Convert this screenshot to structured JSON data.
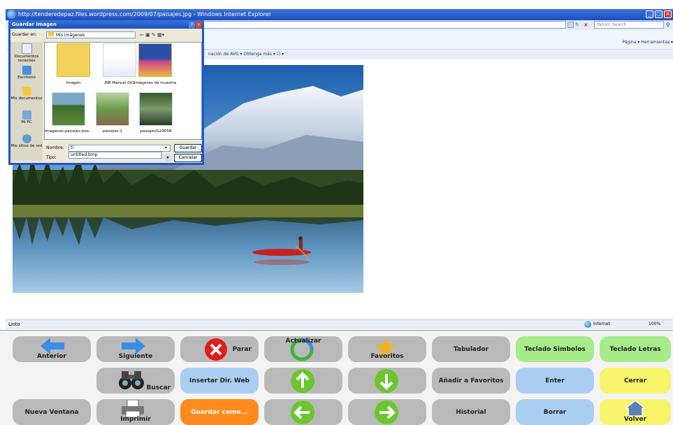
{
  "window": {
    "title": "http://tenderedepaz.files.wordpress.com/2009/07/paisajes.jpg - Windows Internet Explorer",
    "search_placeholder": "Yahoo! Search",
    "links_bar": "nación de AVG ▾   Obtenga más ▾   ☐ ▾",
    "command_bar": "Página ▾   Herramientas ▾",
    "status_left": "Listo",
    "status_zone": "Internet",
    "zoom": "100%"
  },
  "dialog": {
    "title": "Guardar Imagen",
    "save_in_label": "Guardar en:",
    "save_in_value": "Mis imágenes",
    "places": [
      {
        "label": "Documentos recientes"
      },
      {
        "label": "Escritorio"
      },
      {
        "label": "Mis documentos"
      },
      {
        "label": "Mi PC"
      },
      {
        "label": "Mis sitios de red"
      }
    ],
    "files": [
      {
        "label": "Imagen"
      },
      {
        "label": "INE Manuel 001"
      },
      {
        "label": "Imágenes de muestra"
      },
      {
        "label": "imagenes-paisajes-pos..."
      },
      {
        "label": "paisajes-1"
      },
      {
        "label": "paisajes%20058"
      }
    ],
    "name_label": "Nombre:",
    "name_value": "ti",
    "type_label": "Tipo:",
    "type_value": "untitled.bmp",
    "save_button": "Guardar",
    "cancel_button": "Cancelar"
  },
  "keys": {
    "anterior": "Anterior",
    "siguiente": "Siguiente",
    "parar": "Parar",
    "actualizar": "Actualizar",
    "favoritos": "Favoritos",
    "tabulador": "Tabulador",
    "teclado_simbolos": "Teclado Simbolos",
    "teclado_letras": "Teclado Letras",
    "buscar": "Buscar",
    "insertar_dir": "Insertar Dir. Web",
    "anadir_favoritos": "Añadir a Favoritos",
    "enter": "Enter",
    "cerrar": "Cerrar",
    "nueva_ventana": "Nueva Ventana",
    "imprimir": "Imprimir",
    "guardar_como": "Guardar como...",
    "historial": "Historial",
    "borrar": "Borrar",
    "volver": "Volver"
  },
  "colors": {
    "grey_key": "#b9b9b9",
    "blue_key": "#abcdf2",
    "green_key": "#a6ec8a",
    "yellow_key": "#f7f36b",
    "orange_key": "#ff8a1d",
    "title_blue": "#1b4fc0"
  }
}
